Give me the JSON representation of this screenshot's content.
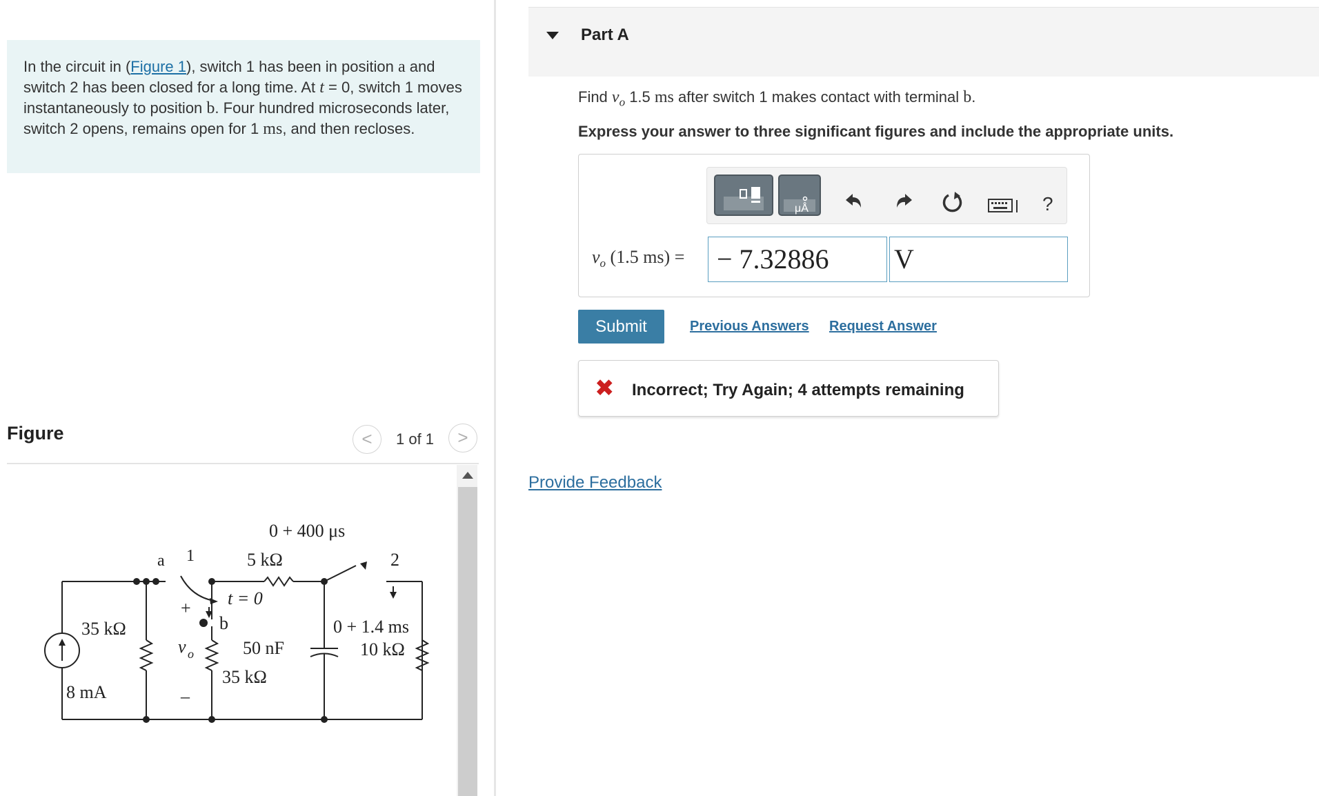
{
  "problem": {
    "text_before_link": "In the circuit in (",
    "figure_link": "Figure 1",
    "text_1": "), switch 1 has been in position ",
    "pos_a": "a",
    "text_2": " and switch 2 has been closed for a long time. At ",
    "t_var": "t",
    "text_3": " = 0, switch 1 moves instantaneously to position ",
    "pos_b": "b",
    "text_4": ". Four hundred microseconds later, switch 2 opens, remains open for 1 ",
    "unit_ms": "ms",
    "text_5": ", and then recloses."
  },
  "figure": {
    "heading": "Figure",
    "counter": "1 of 1",
    "prev_glyph": "<",
    "next_glyph": ">",
    "labels": {
      "top_time": "0 + 400 μs",
      "node_a": "a",
      "switch1": "1",
      "r_5k": "5 kΩ",
      "switch2": "2",
      "t_zero": "t = 0",
      "plus": "+",
      "minus": "–",
      "node_b": "b",
      "vo": "v",
      "vo_sub": "o",
      "r_35k_left": "35 kΩ",
      "source": "8 mA",
      "cap": "50 nF",
      "r_35k_mid": "35 kΩ",
      "time_14": "0 + 1.4 ms",
      "r_10k": "10 kΩ"
    }
  },
  "part_a": {
    "title": "Part A",
    "question_pre": "Find ",
    "question_var": "v",
    "question_sub": "o",
    "question_num": " 1.5 ",
    "question_unit": "ms",
    "question_post": " after switch 1 makes contact with terminal ",
    "question_b": "b",
    "question_end": ".",
    "instruction": "Express your answer to three significant figures and include the appropriate units."
  },
  "answer": {
    "label_var": "v",
    "label_sub": "o",
    "label_rest": " (1.5 ms) =",
    "value": "− 7.32886",
    "unit": "V",
    "toolbar_icons": [
      "templates-icon",
      "units-icon",
      "undo-icon",
      "redo-icon",
      "reset-icon",
      "keyboard-icon",
      "help-icon"
    ],
    "help": "?"
  },
  "actions": {
    "submit": "Submit",
    "previous_answers": "Previous Answers",
    "request_answer": "Request Answer"
  },
  "feedback": {
    "mark": "✖",
    "message": "Incorrect; Try Again; 4 attempts remaining"
  },
  "footer": {
    "provide_feedback": "Provide Feedback"
  },
  "colors": {
    "problem_bg": "#e9f4f5",
    "link": "#2c6e9e",
    "submit_bg": "#3a7ea5",
    "error": "#cc1f1f"
  }
}
